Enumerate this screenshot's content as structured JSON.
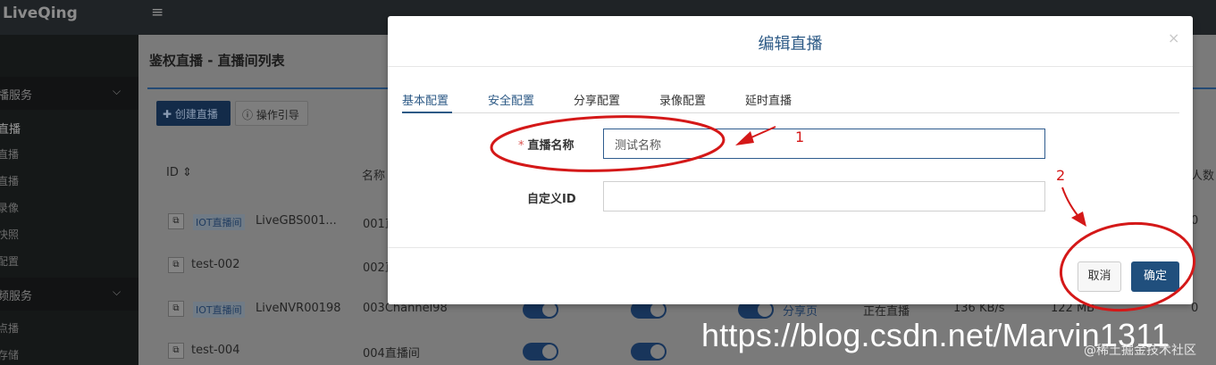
{
  "app": {
    "logo": "LiveQing",
    "menu_icon": "≡"
  },
  "sidebar": {
    "groups": [
      {
        "label": "播服务",
        "chevron": "⌵"
      },
      {
        "label": "频服务",
        "chevron": "⌵"
      }
    ],
    "items_group1": [
      "直播",
      "直播",
      "直播",
      "录像",
      "快照",
      "配置"
    ],
    "items_group2": [
      "点播",
      "存储"
    ]
  },
  "page": {
    "title": "鉴权直播 - 直播间列表",
    "create_button": "创建直播",
    "guide_button": "操作引导",
    "columns": {
      "id": "ID ⇕",
      "name": "名称",
      "viewers": "人数"
    }
  },
  "table": {
    "rows": [
      {
        "tag": "IOT直播间",
        "id": "LiveGBS001...",
        "name": "001直"
      },
      {
        "tag": "",
        "id": "test-002",
        "name": "002直"
      },
      {
        "tag": "IOT直播间",
        "id": "LiveNVR00198",
        "name": "003Channel98",
        "share": "分享页",
        "status": "正在直播",
        "rate": "136 KB/s",
        "size": "122 MB",
        "viewers": "0"
      },
      {
        "tag": "",
        "id": "test-004",
        "name": "004直播间"
      }
    ],
    "row1_viewers": "0"
  },
  "modal": {
    "title": "编辑直播",
    "close": "×",
    "tabs": [
      "基本配置",
      "安全配置",
      "分享配置",
      "录像配置",
      "延时直播"
    ],
    "fields": {
      "name_label": "直播名称",
      "name_required": "*",
      "name_value": "测试名称",
      "custom_id_label": "自定义ID",
      "custom_id_value": ""
    },
    "cancel": "取消",
    "confirm": "确定"
  },
  "annotations": {
    "n1": "1",
    "n2": "2",
    "color": "#d41818"
  },
  "watermark": {
    "url": "https://blog.csdn.net/Marvin1311",
    "sub": "@稀土掘金技术社区"
  }
}
